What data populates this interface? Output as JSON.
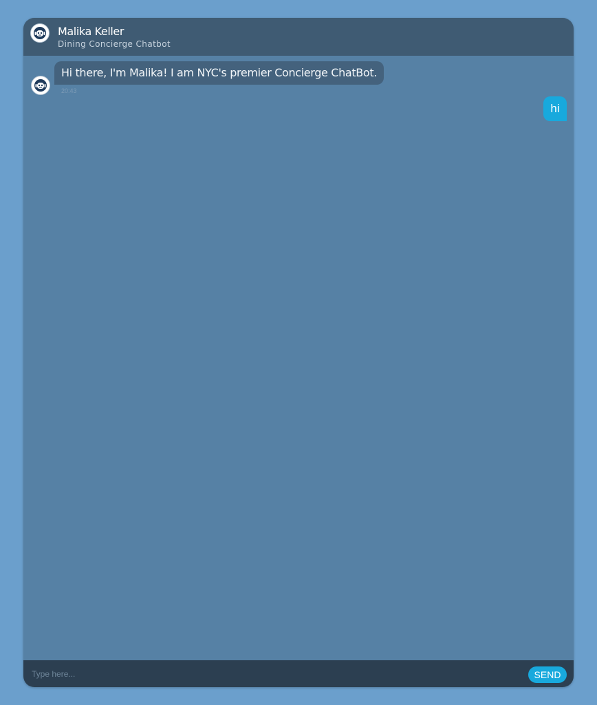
{
  "header": {
    "name": "Malika Keller",
    "subtitle": "Dining Concierge Chatbot",
    "avatar_icon": "robot-face-icon"
  },
  "messages": [
    {
      "sender": "bot",
      "text": "Hi there, I'm Malika! I am NYC's premier Concierge ChatBot.",
      "time": "20:43"
    },
    {
      "sender": "user",
      "text": "hi"
    }
  ],
  "composer": {
    "placeholder": "Type here...",
    "value": "",
    "send_label": "SEND"
  },
  "colors": {
    "page_background": "#6b9fcc",
    "chat_background": "#5681a5",
    "header_background": "#3f5b73",
    "bot_bubble": "#44627d",
    "user_bubble": "#18a9dd",
    "composer_background": "#2c3f51",
    "accent": "#18a9dd"
  }
}
